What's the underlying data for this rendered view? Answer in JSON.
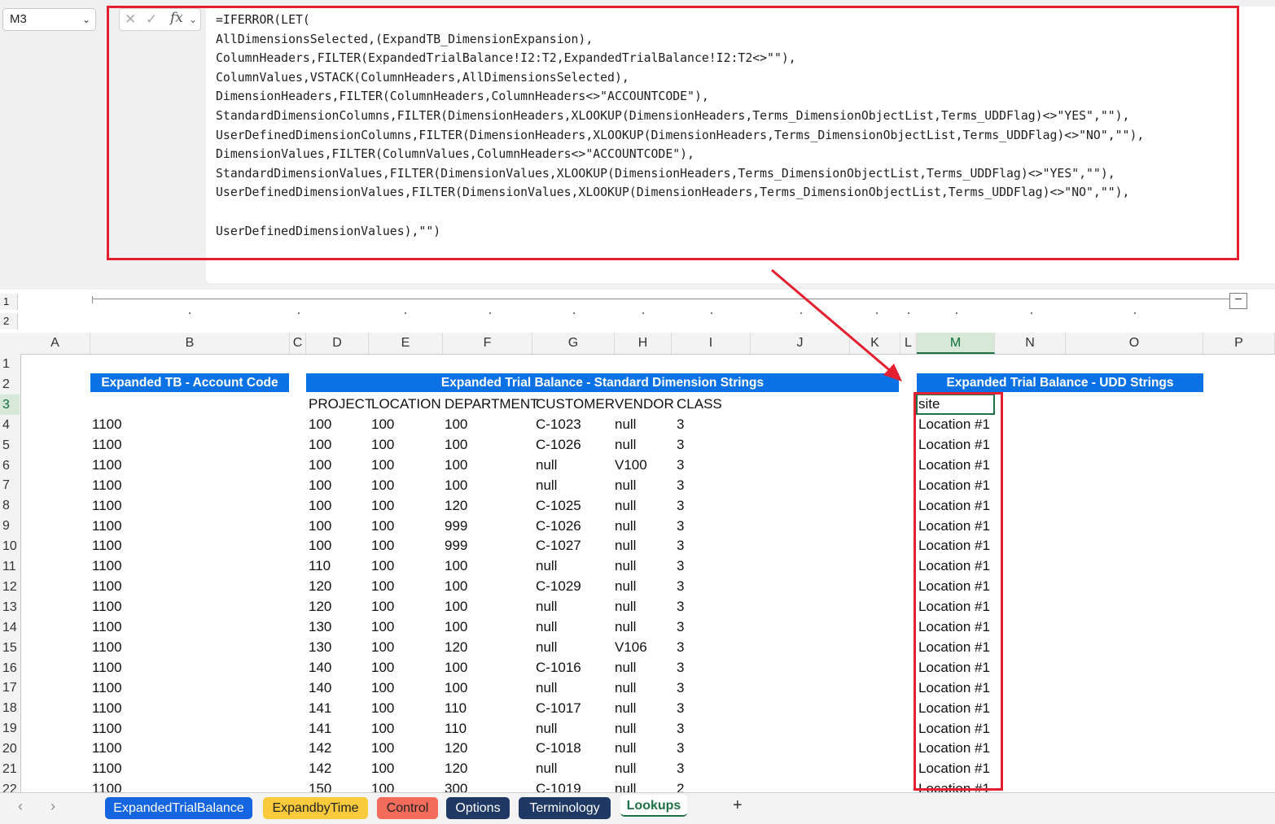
{
  "namebox": {
    "ref": "M3"
  },
  "formula": {
    "lines": [
      "=IFERROR(LET(",
      "AllDimensionsSelected,(ExpandTB_DimensionExpansion),",
      "ColumnHeaders,FILTER(ExpandedTrialBalance!I2:T2,ExpandedTrialBalance!I2:T2<>\"\"),",
      "ColumnValues,VSTACK(ColumnHeaders,AllDimensionsSelected),",
      "DimensionHeaders,FILTER(ColumnHeaders,ColumnHeaders<>\"ACCOUNTCODE\"),",
      "StandardDimensionColumns,FILTER(DimensionHeaders,XLOOKUP(DimensionHeaders,Terms_DimensionObjectList,Terms_UDDFlag)<>\"YES\",\"\"),",
      "UserDefinedDimensionColumns,FILTER(DimensionHeaders,XLOOKUP(DimensionHeaders,Terms_DimensionObjectList,Terms_UDDFlag)<>\"NO\",\"\"),",
      "DimensionValues,FILTER(ColumnValues,ColumnHeaders<>\"ACCOUNTCODE\"),",
      "StandardDimensionValues,FILTER(DimensionValues,XLOOKUP(DimensionHeaders,Terms_DimensionObjectList,Terms_UDDFlag)<>\"YES\",\"\"),",
      "UserDefinedDimensionValues,FILTER(DimensionValues,XLOOKUP(DimensionHeaders,Terms_DimensionObjectList,Terms_UDDFlag)<>\"NO\",\"\"),",
      "",
      "UserDefinedDimensionValues),\"\")"
    ]
  },
  "outline": {
    "levels": [
      "1",
      "2"
    ],
    "collapse": "−"
  },
  "columns": [
    "A",
    "B",
    "C",
    "D",
    "E",
    "F",
    "G",
    "H",
    "I",
    "J",
    "K",
    "L",
    "M",
    "N",
    "O",
    "P"
  ],
  "banners": {
    "account": "Expanded TB - Account Code",
    "standard": "Expanded Trial Balance - Standard Dimension Strings",
    "udd": "Expanded Trial Balance - UDD Strings"
  },
  "headers": [
    "PROJECT",
    "LOCATION",
    "DEPARTMENT",
    "CUSTOMER",
    "VENDOR",
    "CLASS"
  ],
  "udd_header": "site",
  "rows": [
    {
      "n": "4",
      "acct": "1100",
      "p": "100",
      "l": "100",
      "d": "100",
      "c": "C-1023",
      "v": "null",
      "k": "3",
      "m": "Location #1"
    },
    {
      "n": "5",
      "acct": "1100",
      "p": "100",
      "l": "100",
      "d": "100",
      "c": "C-1026",
      "v": "null",
      "k": "3",
      "m": "Location #1"
    },
    {
      "n": "6",
      "acct": "1100",
      "p": "100",
      "l": "100",
      "d": "100",
      "c": "null",
      "v": "V100",
      "k": "3",
      "m": "Location #1"
    },
    {
      "n": "7",
      "acct": "1100",
      "p": "100",
      "l": "100",
      "d": "100",
      "c": "null",
      "v": "null",
      "k": "3",
      "m": "Location #1"
    },
    {
      "n": "8",
      "acct": "1100",
      "p": "100",
      "l": "100",
      "d": "120",
      "c": "C-1025",
      "v": "null",
      "k": "3",
      "m": "Location #1"
    },
    {
      "n": "9",
      "acct": "1100",
      "p": "100",
      "l": "100",
      "d": "999",
      "c": "C-1026",
      "v": "null",
      "k": "3",
      "m": "Location #1"
    },
    {
      "n": "10",
      "acct": "1100",
      "p": "100",
      "l": "100",
      "d": "999",
      "c": "C-1027",
      "v": "null",
      "k": "3",
      "m": "Location #1"
    },
    {
      "n": "11",
      "acct": "1100",
      "p": "110",
      "l": "100",
      "d": "100",
      "c": "null",
      "v": "null",
      "k": "3",
      "m": "Location #1"
    },
    {
      "n": "12",
      "acct": "1100",
      "p": "120",
      "l": "100",
      "d": "100",
      "c": "C-1029",
      "v": "null",
      "k": "3",
      "m": "Location #1"
    },
    {
      "n": "13",
      "acct": "1100",
      "p": "120",
      "l": "100",
      "d": "100",
      "c": "null",
      "v": "null",
      "k": "3",
      "m": "Location #1"
    },
    {
      "n": "14",
      "acct": "1100",
      "p": "130",
      "l": "100",
      "d": "100",
      "c": "null",
      "v": "null",
      "k": "3",
      "m": "Location #1"
    },
    {
      "n": "15",
      "acct": "1100",
      "p": "130",
      "l": "100",
      "d": "120",
      "c": "null",
      "v": "V106",
      "k": "3",
      "m": "Location #1"
    },
    {
      "n": "16",
      "acct": "1100",
      "p": "140",
      "l": "100",
      "d": "100",
      "c": "C-1016",
      "v": "null",
      "k": "3",
      "m": "Location #1"
    },
    {
      "n": "17",
      "acct": "1100",
      "p": "140",
      "l": "100",
      "d": "100",
      "c": "null",
      "v": "null",
      "k": "3",
      "m": "Location #1"
    },
    {
      "n": "18",
      "acct": "1100",
      "p": "141",
      "l": "100",
      "d": "110",
      "c": "C-1017",
      "v": "null",
      "k": "3",
      "m": "Location #1"
    },
    {
      "n": "19",
      "acct": "1100",
      "p": "141",
      "l": "100",
      "d": "110",
      "c": "null",
      "v": "null",
      "k": "3",
      "m": "Location #1"
    },
    {
      "n": "20",
      "acct": "1100",
      "p": "142",
      "l": "100",
      "d": "120",
      "c": "C-1018",
      "v": "null",
      "k": "3",
      "m": "Location #1"
    },
    {
      "n": "21",
      "acct": "1100",
      "p": "142",
      "l": "100",
      "d": "120",
      "c": "null",
      "v": "null",
      "k": "3",
      "m": "Location #1"
    },
    {
      "n": "22",
      "acct": "1100",
      "p": "150",
      "l": "100",
      "d": "300",
      "c": "C-1019",
      "v": "null",
      "k": "2",
      "m": "Location #1"
    }
  ],
  "tabs": [
    {
      "label": "ExpandedTrialBalance",
      "bg": "#1565e0",
      "fg": "#ffffff"
    },
    {
      "label": "ExpandbyTime",
      "bg": "#f9cb3c",
      "fg": "#222222"
    },
    {
      "label": "Control",
      "bg": "#f26b5b",
      "fg": "#222222"
    },
    {
      "label": "Options",
      "bg": "#1f3864",
      "fg": "#ffffff"
    },
    {
      "label": "Terminology",
      "bg": "#1f3864",
      "fg": "#ffffff"
    },
    {
      "label": "Lookups",
      "bg": "#ffffff",
      "fg": "#1e7145"
    }
  ],
  "add_sheet": "+",
  "colors": {
    "highlight": "#e41f30",
    "banner": "#0b72e6",
    "selection": "#1e7145"
  }
}
